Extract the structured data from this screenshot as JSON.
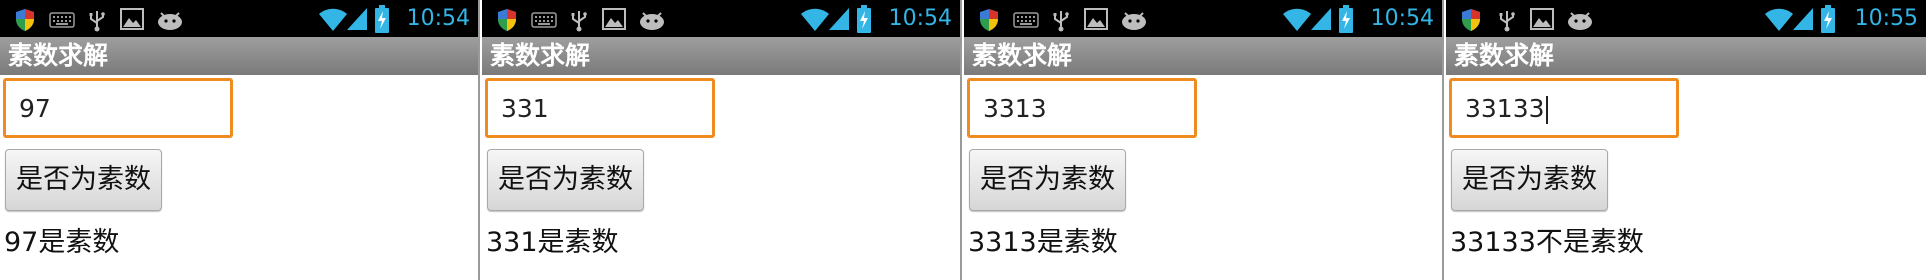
{
  "panels": [
    {
      "time": "10:54",
      "app_title": "素数求解",
      "input_value": "97",
      "button_label": "是否为素数",
      "result_text": "97是素数"
    },
    {
      "time": "10:54",
      "app_title": "素数求解",
      "input_value": "331",
      "button_label": "是否为素数",
      "result_text": "331是素数"
    },
    {
      "time": "10:54",
      "app_title": "素数求解",
      "input_value": "3313",
      "button_label": "是否为素数",
      "result_text": "3313是素数"
    },
    {
      "time": "10:55",
      "app_title": "素数求解",
      "input_value": "33133",
      "button_label": "是否为素数",
      "result_text": "33133不是素数"
    }
  ],
  "status_icons": [
    "shield-icon",
    "keyboard-icon",
    "usb-icon",
    "gallery-icon",
    "android-icon",
    "wifi-icon",
    "signal-icon",
    "battery-charging-icon"
  ],
  "colors": {
    "clock": "#33b5e5",
    "focus_border": "#f08c1f",
    "title_bar": "#8a8a8a",
    "status_bar": "#000000"
  }
}
